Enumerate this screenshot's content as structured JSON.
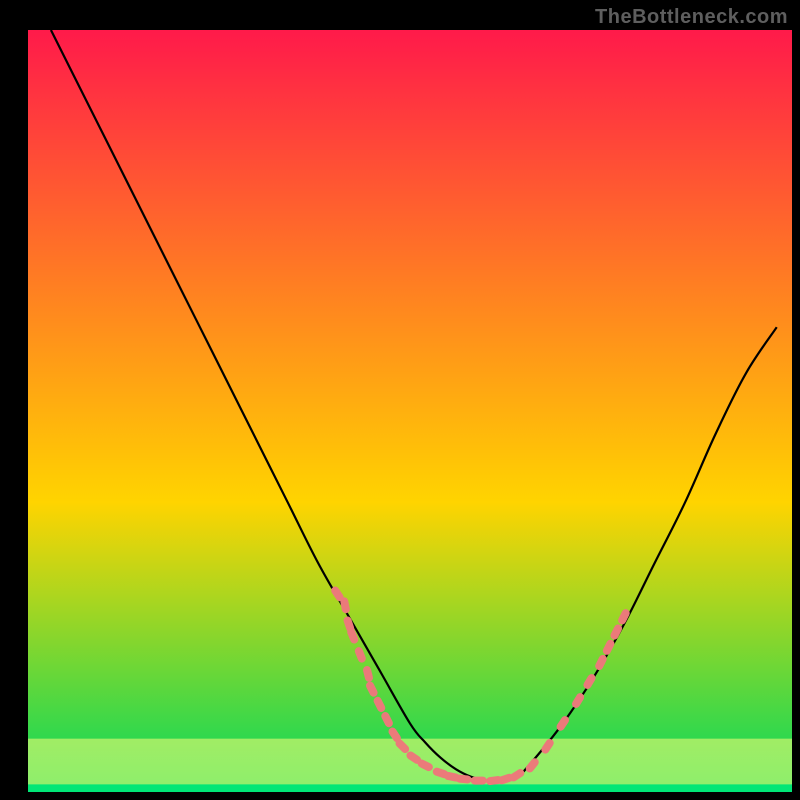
{
  "attribution": "TheBottleneck.com",
  "chart_data": {
    "type": "line",
    "title": "",
    "xlabel": "",
    "ylabel": "",
    "xlim": [
      0,
      100
    ],
    "ylim": [
      0,
      100
    ],
    "x": [
      3,
      6,
      10,
      14,
      18,
      22,
      26,
      30,
      34,
      38,
      42,
      46,
      50,
      52,
      54,
      56,
      58,
      60,
      62,
      64,
      66,
      70,
      74,
      78,
      82,
      86,
      90,
      94,
      98
    ],
    "y_line": [
      100,
      94,
      86,
      78,
      70,
      62,
      54,
      46,
      38,
      30,
      23,
      16,
      9,
      6.5,
      4.5,
      3,
      2,
      1.5,
      1.5,
      2,
      4,
      9,
      15,
      22,
      30,
      38,
      47,
      55,
      61
    ],
    "bottom_band_top": [
      1,
      1,
      1,
      1,
      1,
      1,
      1,
      1,
      1,
      1,
      1,
      1,
      1,
      1,
      1,
      1,
      1,
      1,
      1,
      1,
      1,
      1,
      1,
      1,
      1,
      1,
      1,
      1,
      1
    ],
    "yellow_band_top": [
      7,
      7,
      7,
      7,
      7,
      7,
      7,
      7,
      7,
      7,
      7,
      7,
      7,
      7,
      7,
      7,
      7,
      7,
      7,
      7,
      7,
      7,
      7,
      7,
      7,
      7,
      7,
      7,
      7
    ],
    "dashes": [
      {
        "x": 40.5,
        "y": 26
      },
      {
        "x": 41.5,
        "y": 24.5
      },
      {
        "x": 42,
        "y": 22
      },
      {
        "x": 42.5,
        "y": 20.5
      },
      {
        "x": 43.5,
        "y": 18
      },
      {
        "x": 44.5,
        "y": 15.5
      },
      {
        "x": 45,
        "y": 13.5
      },
      {
        "x": 46,
        "y": 11.5
      },
      {
        "x": 47,
        "y": 9.5
      },
      {
        "x": 48,
        "y": 7.5
      },
      {
        "x": 49,
        "y": 6
      },
      {
        "x": 50.5,
        "y": 4.5
      },
      {
        "x": 52,
        "y": 3.5
      },
      {
        "x": 54,
        "y": 2.5
      },
      {
        "x": 55.5,
        "y": 2
      },
      {
        "x": 57,
        "y": 1.7
      },
      {
        "x": 59,
        "y": 1.5
      },
      {
        "x": 61,
        "y": 1.5
      },
      {
        "x": 62.5,
        "y": 1.7
      },
      {
        "x": 64,
        "y": 2.2
      },
      {
        "x": 66,
        "y": 3.5
      },
      {
        "x": 68,
        "y": 6
      },
      {
        "x": 70,
        "y": 9
      },
      {
        "x": 72,
        "y": 12
      },
      {
        "x": 73.5,
        "y": 14.5
      },
      {
        "x": 75,
        "y": 17
      },
      {
        "x": 76,
        "y": 19
      },
      {
        "x": 77,
        "y": 21
      },
      {
        "x": 78,
        "y": 23
      }
    ],
    "gradient": {
      "top_color": "#ff1a4a",
      "mid_color": "#ffd400",
      "bottom_color": "#00d95f"
    },
    "dash_color": "#eb7a7a",
    "line_color": "#000000",
    "frame_color": "#000000"
  }
}
